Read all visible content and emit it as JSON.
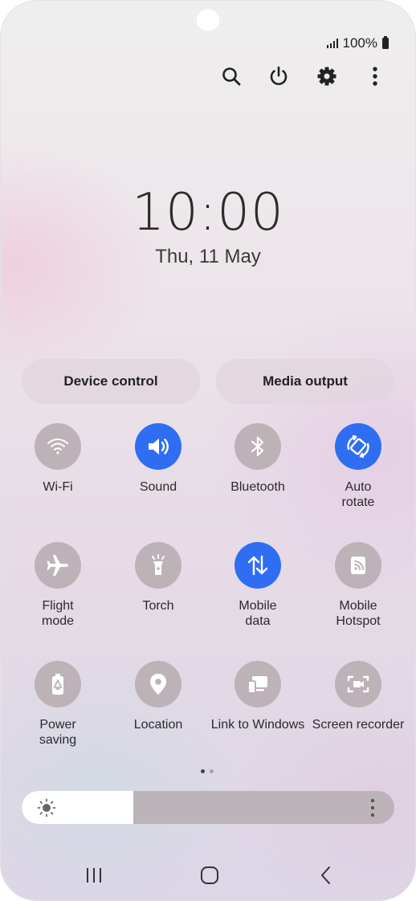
{
  "status": {
    "battery_text": "100%"
  },
  "top_actions": [
    {
      "name": "search-icon"
    },
    {
      "name": "power-icon"
    },
    {
      "name": "settings-icon"
    },
    {
      "name": "more-options-icon"
    }
  ],
  "clock": {
    "time": "10:00",
    "date": "Thu, 11 May"
  },
  "pills": {
    "device_control": "Device control",
    "media_output": "Media output"
  },
  "tiles": [
    {
      "label": "Wi-Fi",
      "icon": "wifi-icon",
      "on": false
    },
    {
      "label": "Sound",
      "icon": "sound-icon",
      "on": true
    },
    {
      "label": "Bluetooth",
      "icon": "bluetooth-icon",
      "on": false
    },
    {
      "label": "Auto\nrotate",
      "icon": "auto-rotate-icon",
      "on": true
    },
    {
      "label": "Flight\nmode",
      "icon": "airplane-icon",
      "on": false
    },
    {
      "label": "Torch",
      "icon": "torch-icon",
      "on": false
    },
    {
      "label": "Mobile\ndata",
      "icon": "mobile-data-icon",
      "on": true
    },
    {
      "label": "Mobile\nHotspot",
      "icon": "hotspot-icon",
      "on": false
    },
    {
      "label": "Power\nsaving",
      "icon": "battery-saver-icon",
      "on": false
    },
    {
      "label": "Location",
      "icon": "location-icon",
      "on": false
    },
    {
      "label": "Link to Windows",
      "icon": "link-to-windows-icon",
      "on": false
    },
    {
      "label": "Screen recorder",
      "icon": "screen-recorder-icon",
      "on": false
    }
  ],
  "pager": {
    "pages": 2,
    "current": 1
  },
  "brightness": {
    "level": 0.3
  },
  "colors": {
    "accent": "#2f6ef2",
    "tile_off": "#bdb2b8"
  },
  "navigation": [
    {
      "name": "recent-apps-button"
    },
    {
      "name": "home-button"
    },
    {
      "name": "back-button"
    }
  ]
}
